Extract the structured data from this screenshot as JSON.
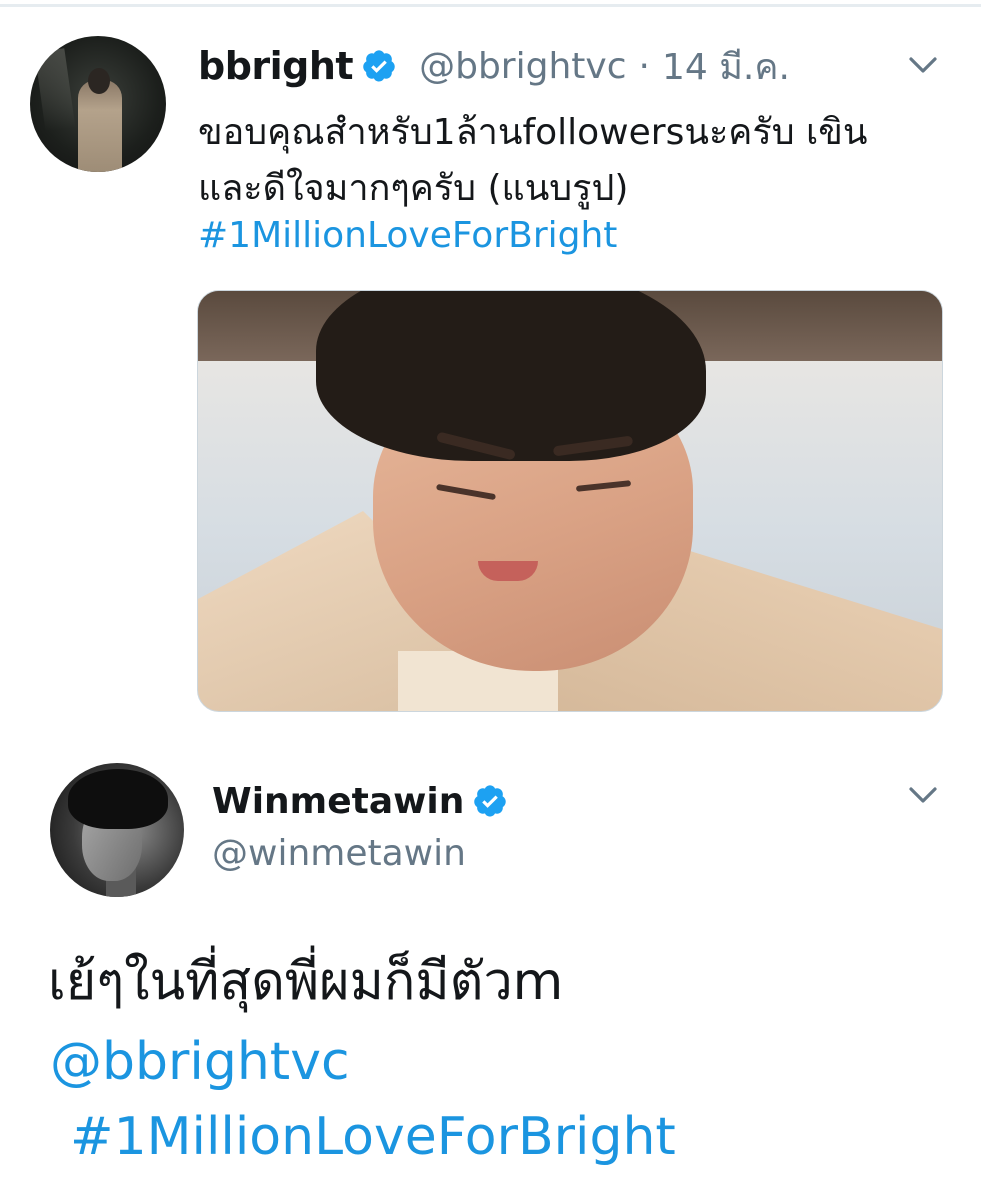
{
  "tweets": [
    {
      "display_name": "bbright",
      "handle": "@bbrightvc",
      "separator": "·",
      "time": "14 มี.ค.",
      "text_lines": [
        "ขอบคุณสำหรับ1ล้านfollowersนะครับ เขิน",
        "และดีใจมากๆครับ (แนบรูป)"
      ],
      "hashtag": "#1MillionLoveForBright",
      "verified": true,
      "avatar_icon": "profile-photo",
      "menu_icon": "chevron-down-icon"
    },
    {
      "display_name": "Winmetawin",
      "handle": "@winmetawin",
      "text": "เย้ๆในที่สุดพี่ผมก็มีตัวm",
      "mention": "@bbrightvc",
      "hashtag": "#1MillionLoveForBright",
      "verified": true,
      "avatar_icon": "profile-photo",
      "menu_icon": "chevron-down-icon"
    }
  ],
  "colors": {
    "link": "#1b95e0",
    "secondary_text": "#657786",
    "primary_text": "#14171a",
    "verified": "#1da1f2",
    "border": "#ccd6dd"
  }
}
